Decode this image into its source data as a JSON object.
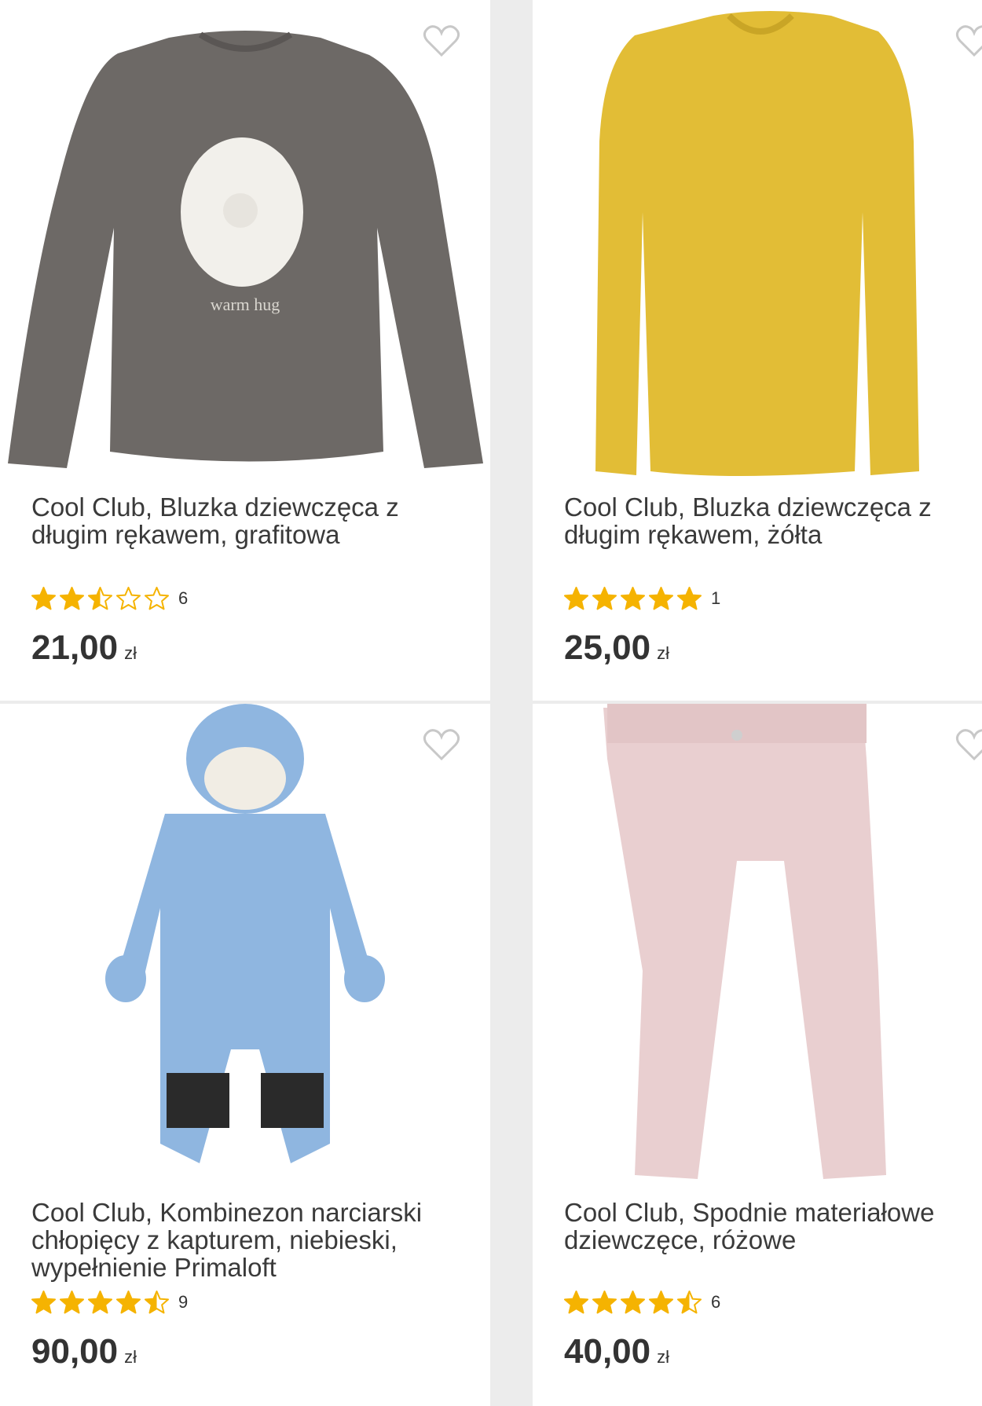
{
  "products": [
    {
      "title": "Cool Club, Bluzka dziewczęca z długim rękawem, grafitowa",
      "rating": 2.5,
      "reviews": "6",
      "price": "21,00",
      "currency": "zł",
      "color": "#6d6966",
      "print_text": "warm hug"
    },
    {
      "title": "Cool Club, Bluzka dziewczęca z długim rękawem, żółta",
      "rating": 5,
      "reviews": "1",
      "price": "25,00",
      "currency": "zł",
      "color": "#e2bd36"
    },
    {
      "title": "Cool Club, Kombinezon narciarski chłopięcy z kapturem, niebieski, wypełnienie Primaloft",
      "rating": 4.5,
      "reviews": "9",
      "price": "90,00",
      "currency": "zł",
      "color": "#8fb6e0"
    },
    {
      "title": "Cool Club, Spodnie materiałowe dziewczęce, różowe",
      "rating": 4.5,
      "reviews": "6",
      "price": "40,00",
      "currency": "zł",
      "color": "#e9cfd0"
    }
  ],
  "colors": {
    "star": "#f5b301",
    "heart": "#c8c8c8"
  }
}
